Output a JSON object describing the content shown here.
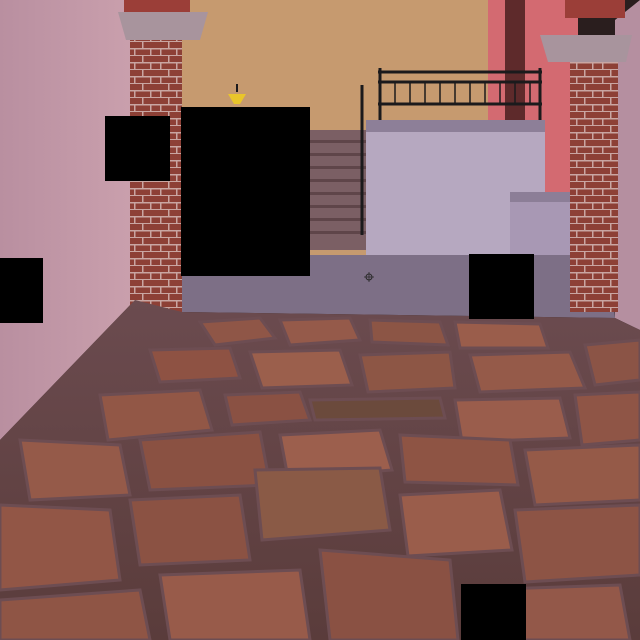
{
  "scene": {
    "colors": {
      "back_wall": "#c69a6f",
      "left_wall": "#b58e9c",
      "right_wall_pink": "#d46a72",
      "brick": "#8a3e34",
      "stone_light": "#9a5a49",
      "stone_dark": "#6f3f37",
      "grout": "#7a5a5e",
      "platform": "#a99ab6",
      "railing": "#1b1a1c",
      "stairs": "#7b5f64",
      "lamp": "#e9c52a"
    },
    "icons": {
      "crosshair": "crosshair-icon",
      "lamp": "lamp-icon"
    }
  }
}
